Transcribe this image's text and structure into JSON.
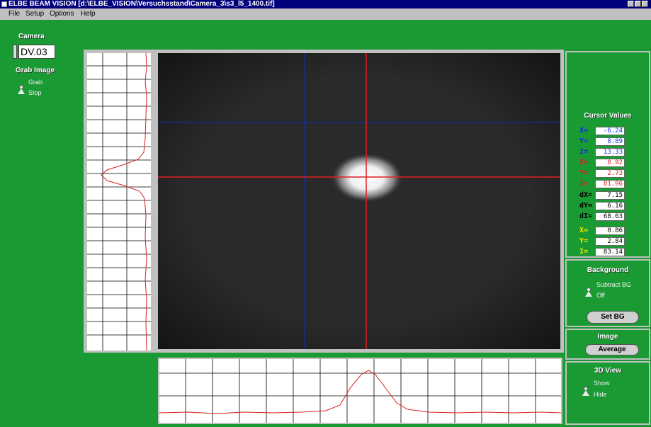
{
  "window": {
    "title": "ELBE BEAM VISION [d:\\ELBE_VISION\\Versuchsstand\\Camera_3\\s3_l5_1400.tif]"
  },
  "menu": {
    "items": [
      "File",
      "Setup",
      "Options",
      "Help"
    ]
  },
  "left_panel": {
    "camera_label": "Camera",
    "camera_value": "DV.03",
    "grab_label": "Grab Image",
    "grab_option": "Grab",
    "stop_option": "Stop"
  },
  "cursor_values": {
    "title": "Cursor Values",
    "rows": [
      {
        "label": "X=",
        "value": "-6.24",
        "color": "#1030e0"
      },
      {
        "label": "Y=",
        "value": "8.89",
        "color": "#1030e0"
      },
      {
        "label": "I=",
        "value": "13.33",
        "color": "#1030e0"
      },
      {
        "label": "X=",
        "value": "0.92",
        "color": "#e02020"
      },
      {
        "label": "Y=",
        "value": "2.73",
        "color": "#e02020"
      },
      {
        "label": "I=",
        "value": "81.96",
        "color": "#e02020"
      },
      {
        "label": "dX=",
        "value": "7.15",
        "color": "#000000"
      },
      {
        "label": "dY=",
        "value": "6.16",
        "color": "#000000"
      },
      {
        "label": "dI=",
        "value": "68.63",
        "color": "#000000"
      },
      {
        "label": "X=",
        "value": "0.86",
        "color": "#e8e800"
      },
      {
        "label": "Y=",
        "value": "2.84",
        "color": "#e8e800"
      },
      {
        "label": "I=",
        "value": "83.14",
        "color": "#e8e800"
      }
    ]
  },
  "background": {
    "title": "Background",
    "subtract_option": "Subtract BG",
    "off_option": "Off",
    "set_bg_button": "Set BG"
  },
  "image_panel": {
    "title": "Image",
    "average_button": "Average"
  },
  "view3d": {
    "title": "3D View",
    "show_option": "Show",
    "hide_option": "Hide"
  },
  "colors": {
    "panel_green": "#1a9a33",
    "cursor_blue": "#1030e0",
    "cursor_red": "#e02020",
    "profile_red": "#d82020"
  }
}
